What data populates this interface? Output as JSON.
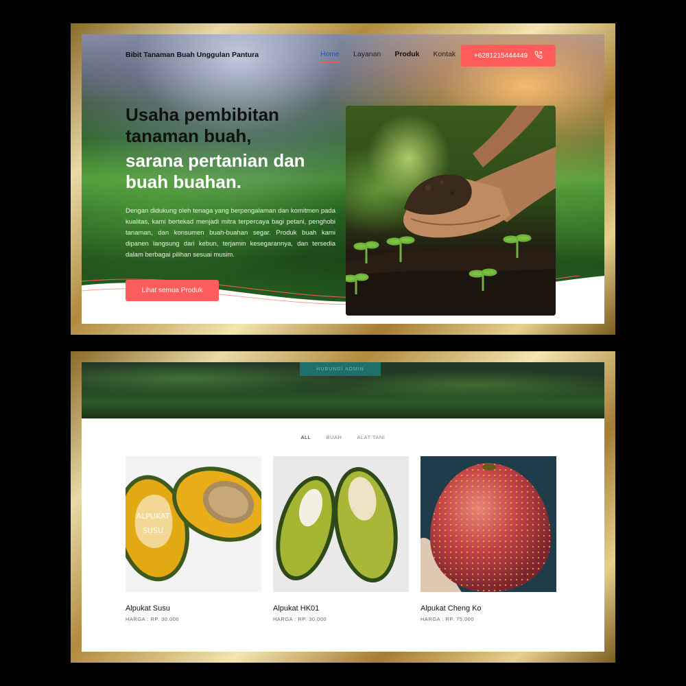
{
  "hero": {
    "brand": "Bibit Tanaman Buah Unggulan Pantura",
    "nav": [
      {
        "label": "Home"
      },
      {
        "label": "Layanan"
      },
      {
        "label": "Produk"
      },
      {
        "label": "Kontak"
      }
    ],
    "phone": "+6281215444449",
    "title_line1": "Usaha pembibitan tanaman buah,",
    "title_line2": "sarana pertanian dan buah buahan.",
    "description": "Dengan didukung oleh tenaga yang berpengalaman dan komitmen pada kualitas, kami bertekad menjadi mitra terpercaya bagi petani, penghobi tanaman, dan konsumen buah-buahan segar. Produk buah kami dipanen langsung dari kebun, terjamin kesegarannya, dan tersedia dalam berbagai pilihan sesuai musim.",
    "cta": "Lihat semua Produk"
  },
  "products_section": {
    "banner_button": "HUBUNGI ADMIN",
    "filters": [
      "ALL",
      "BUAH",
      "ALAT TANI"
    ],
    "items": [
      {
        "name": "Alpukat Susu",
        "price": "HARGA : RP. 30.000",
        "image_text_1": "ALPUKAT",
        "image_text_2": "SUSU"
      },
      {
        "name": "Alpukat HK01",
        "price": "HARGA : RP. 30.000"
      },
      {
        "name": "Alpukat Cheng Ko",
        "price": "HARGA : RP. 75.000"
      }
    ]
  },
  "colors": {
    "accent": "#ff5c5c",
    "nav_active": "#2a4bd0",
    "gold_frame": "#c9a456"
  }
}
